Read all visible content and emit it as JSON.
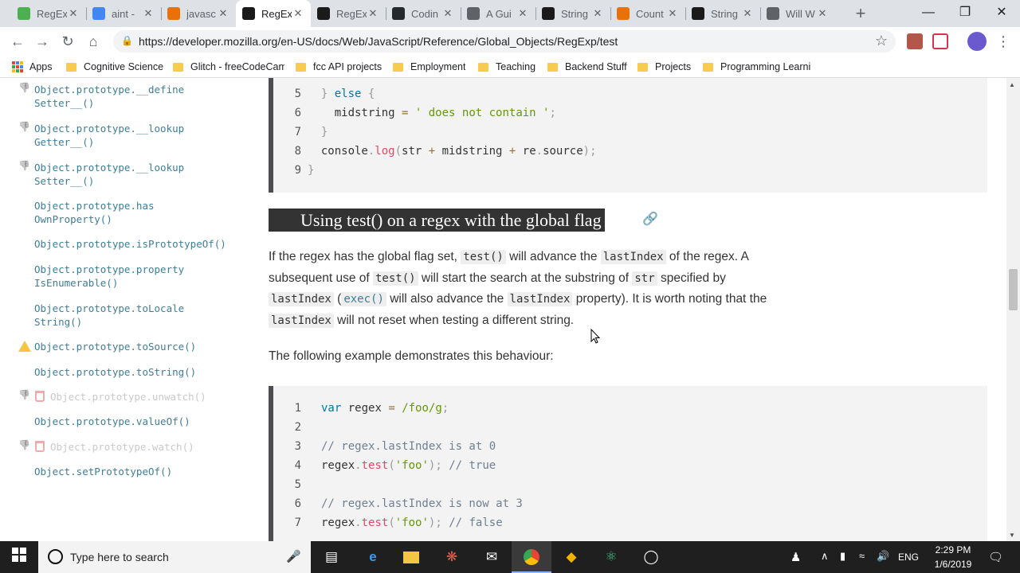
{
  "browser": {
    "tabs": [
      {
        "title": "RegEx",
        "favicon_color": "#4caf50",
        "favicon_glyph": "fcc"
      },
      {
        "title": "aint -",
        "favicon_color": "#4285f4",
        "favicon_glyph": "G"
      },
      {
        "title": "javasc",
        "favicon_color": "#e8710a",
        "favicon_glyph": "so"
      },
      {
        "title": "RegEx",
        "favicon_color": "#1a1a1a",
        "favicon_glyph": "mdn",
        "active": true
      },
      {
        "title": "RegEx",
        "favicon_color": "#1a1a1a",
        "favicon_glyph": "mdn"
      },
      {
        "title": "Codin",
        "favicon_color": "#24292e",
        "favicon_glyph": "gh"
      },
      {
        "title": "A Gui",
        "favicon_color": "#5f6368",
        "favicon_glyph": "doc"
      },
      {
        "title": "String",
        "favicon_color": "#1a1a1a",
        "favicon_glyph": "mdn"
      },
      {
        "title": "Count",
        "favicon_color": "#e8710a",
        "favicon_glyph": "so"
      },
      {
        "title": "String",
        "favicon_color": "#1a1a1a",
        "favicon_glyph": "mdn"
      },
      {
        "title": "Will W",
        "favicon_color": "#5f6368",
        "favicon_glyph": "doc"
      }
    ],
    "url": "https://developer.mozilla.org/en-US/docs/Web/JavaScript/Reference/Global_Objects/RegExp/test",
    "bookmarks": [
      "Apps",
      "Cognitive Science",
      "Glitch - freeCodeCam",
      "fcc API projects",
      "Employment",
      "Teaching",
      "Backend Stuff",
      "Projects",
      "Programming Learnin"
    ]
  },
  "sidebar": {
    "items": [
      {
        "line1": "Object.prototype.__define",
        "line2": "Setter__()",
        "icon": "thumbs-down"
      },
      {
        "line1": "Object.prototype.__lookup",
        "line2": "Getter__()",
        "icon": "thumbs-down"
      },
      {
        "line1": "Object.prototype.__lookup",
        "line2": "Setter__()",
        "icon": "thumbs-down"
      },
      {
        "line1": "Object.prototype.has",
        "line2": "OwnProperty()"
      },
      {
        "line1": "Object.prototype.isPrototypeOf()"
      },
      {
        "line1": "Object.prototype.property",
        "line2": "IsEnumerable()"
      },
      {
        "line1": "Object.prototype.toLocale",
        "line2": "String()"
      },
      {
        "line1": "Object.prototype.toSource()",
        "icon": "warning"
      },
      {
        "line1": "Object.prototype.toString()"
      },
      {
        "line1": "Object.prototype.unwatch()",
        "icon": "thumbs-down-trash",
        "deprecated": true
      },
      {
        "line1": "Object.prototype.valueOf()"
      },
      {
        "line1": "Object.prototype.watch()",
        "icon": "thumbs-down-trash",
        "deprecated": true
      },
      {
        "line1": "Object.setPrototypeOf()"
      }
    ]
  },
  "content": {
    "code1": {
      "line_numbers": [
        "5",
        "6",
        "7",
        "8",
        "9"
      ],
      "lines": [
        "  } else {",
        "    midstring = ' does not contain ';",
        "  }",
        "  console.log(str + midstring + re.source);",
        "}"
      ]
    },
    "heading": "Using test() on a regex with the global flag",
    "para1": {
      "t1": "If the regex has the global flag set, ",
      "c1": "test()",
      "t2": " will advance the ",
      "c2": "lastIndex",
      "t3": " of the regex. A",
      "t4": "subsequent use of ",
      "c3": "test()",
      "t5": " will start the search at the substring of ",
      "c4": "str",
      "t6": " specified by",
      "c5": "lastIndex",
      "t7": " (",
      "c6": "exec()",
      "t8": " will also advance the ",
      "c7": "lastIndex",
      "t9": " property). It is worth noting that the",
      "c8": "lastIndex",
      "t10": " will not reset when testing a different string."
    },
    "para2": "The following example demonstrates this behaviour:",
    "code2": {
      "line_numbers": [
        "1",
        "2",
        "3",
        "4",
        "5",
        "6",
        "7"
      ],
      "lines": [
        "var regex = /foo/g;",
        "",
        "// regex.lastIndex is at 0",
        "regex.test('foo'); // true",
        "",
        "// regex.lastIndex is now at 3",
        "regex.test('foo'); // false"
      ]
    }
  },
  "taskbar": {
    "search_placeholder": "Type here to search",
    "language": "ENG",
    "time": "2:29 PM",
    "date": "1/6/2019"
  }
}
